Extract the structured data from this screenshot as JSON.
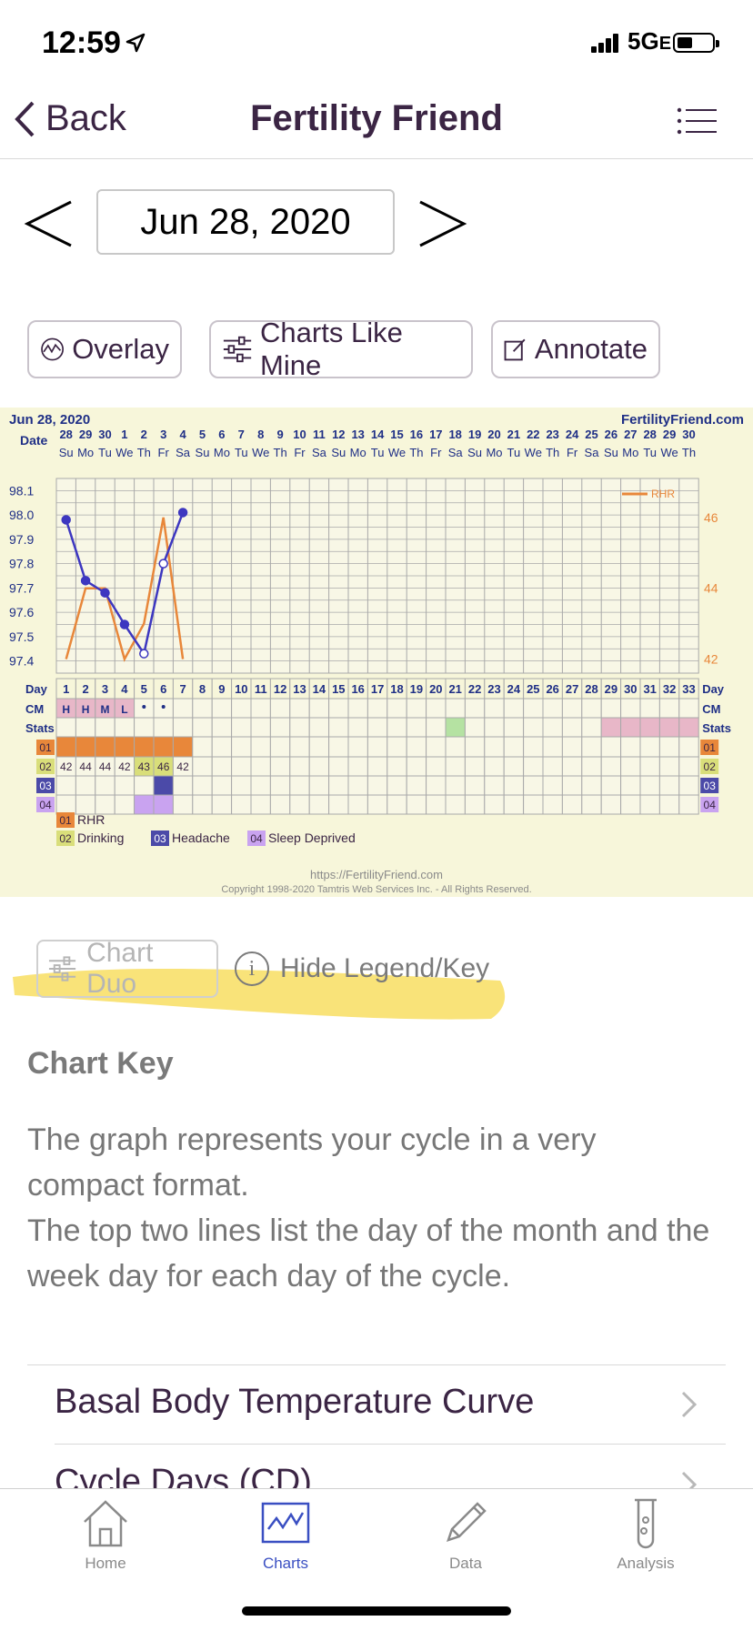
{
  "status_bar": {
    "time": "12:59",
    "network": "5G",
    "network_suffix": "E"
  },
  "nav": {
    "back_label": "Back",
    "title": "Fertility Friend"
  },
  "date_picker": {
    "date": "Jun 28, 2020"
  },
  "actions": {
    "overlay": "Overlay",
    "charts_like_mine": "Charts Like Mine",
    "annotate": "Annotate"
  },
  "chart": {
    "date_label": "Jun 28, 2020",
    "site": "FertilityFriend.com",
    "dates": [
      "28",
      "29",
      "30",
      "1",
      "2",
      "3",
      "4",
      "5",
      "6",
      "7",
      "8",
      "9",
      "10",
      "11",
      "12",
      "13",
      "14",
      "15",
      "16",
      "17",
      "18",
      "19",
      "20",
      "21",
      "22",
      "23",
      "24",
      "25",
      "26",
      "27",
      "28",
      "29",
      "30"
    ],
    "weekdays": [
      "Su",
      "Mo",
      "Tu",
      "We",
      "Th",
      "Fr",
      "Sa",
      "Su",
      "Mo",
      "Tu",
      "We",
      "Th",
      "Fr",
      "Sa",
      "Su",
      "Mo",
      "Tu",
      "We",
      "Th",
      "Fr",
      "Sa",
      "Su",
      "Mo",
      "Tu",
      "We",
      "Th",
      "Fr",
      "Sa",
      "Su",
      "Mo",
      "Tu",
      "We",
      "Th"
    ],
    "row_labels": {
      "date": "Date",
      "day": "Day",
      "cm": "CM",
      "stats": "Stats"
    },
    "cm_values": [
      "H",
      "H",
      "M",
      "L"
    ],
    "rhr_values": [
      "42",
      "44",
      "44",
      "42",
      "43",
      "46",
      "42"
    ],
    "stat_rows": [
      "01",
      "02",
      "03",
      "04"
    ],
    "legend_rhr": "RHR",
    "footer_url": "https://FertilityFriend.com",
    "footer_copyright": "Copyright 1998-2020 Tamtris Web Services Inc. - All Rights Reserved.",
    "legend_items": [
      {
        "code": "01",
        "label": "RHR",
        "color": "#e8873a"
      },
      {
        "code": "02",
        "label": "Drinking",
        "color": "#d9de7a"
      },
      {
        "code": "03",
        "label": "Headache",
        "color": "#4b4aa8"
      },
      {
        "code": "04",
        "label": "Sleep Deprived",
        "color": "#c9a3f0"
      }
    ],
    "colors": {
      "temp_line": "#3d37c0",
      "rhr_line": "#e8873a",
      "grid": "#a9a9a9",
      "background": "#f7f6da",
      "label_blue": "#1f2f86",
      "stats_green": "#b5e2a2",
      "stats_pink": "#e8b7c8",
      "cm_pink": "#e8b7c8"
    }
  },
  "chart_data": {
    "type": "line",
    "x": [
      1,
      2,
      3,
      4,
      5,
      6,
      7
    ],
    "xlabel": "Day",
    "ylim": [
      97.4,
      98.1
    ],
    "series": [
      {
        "values": [
          97.98,
          97.73,
          97.68,
          97.55,
          97.43,
          97.8,
          98.01
        ]
      },
      {
        "name": "RHR",
        "values": [
          42,
          44,
          44,
          42,
          43,
          46,
          42
        ]
      }
    ],
    "y_ticks_left": [
      "98.1",
      "98.0",
      "97.9",
      "97.8",
      "97.7",
      "97.6",
      "97.5",
      "97.4"
    ],
    "y_ticks_right": [
      "46",
      "44",
      "42"
    ],
    "legend_position": "top-right"
  },
  "chart_duo": {
    "label": "Chart Duo"
  },
  "legend_toggle": {
    "icon": "i",
    "label": "Hide Legend/Key"
  },
  "chart_key": {
    "title": "Chart Key",
    "paragraph1": "The graph represents your cycle in a very compact format.",
    "paragraph2": "The top two lines list the day of the month and the week day for each day of the cycle."
  },
  "list": [
    {
      "label": "Basal Body Temperature Curve"
    },
    {
      "label": "Cycle Days (CD)"
    }
  ],
  "tabs": [
    {
      "label": "Home",
      "icon": "home-icon"
    },
    {
      "label": "Charts",
      "icon": "charts-icon",
      "active": true
    },
    {
      "label": "Data",
      "icon": "pencil-icon"
    },
    {
      "label": "Analysis",
      "icon": "test-tube-icon"
    }
  ],
  "colors": {
    "accent": "#3a4fc2",
    "title": "#3b2544",
    "highlight": "#f7d94c"
  }
}
